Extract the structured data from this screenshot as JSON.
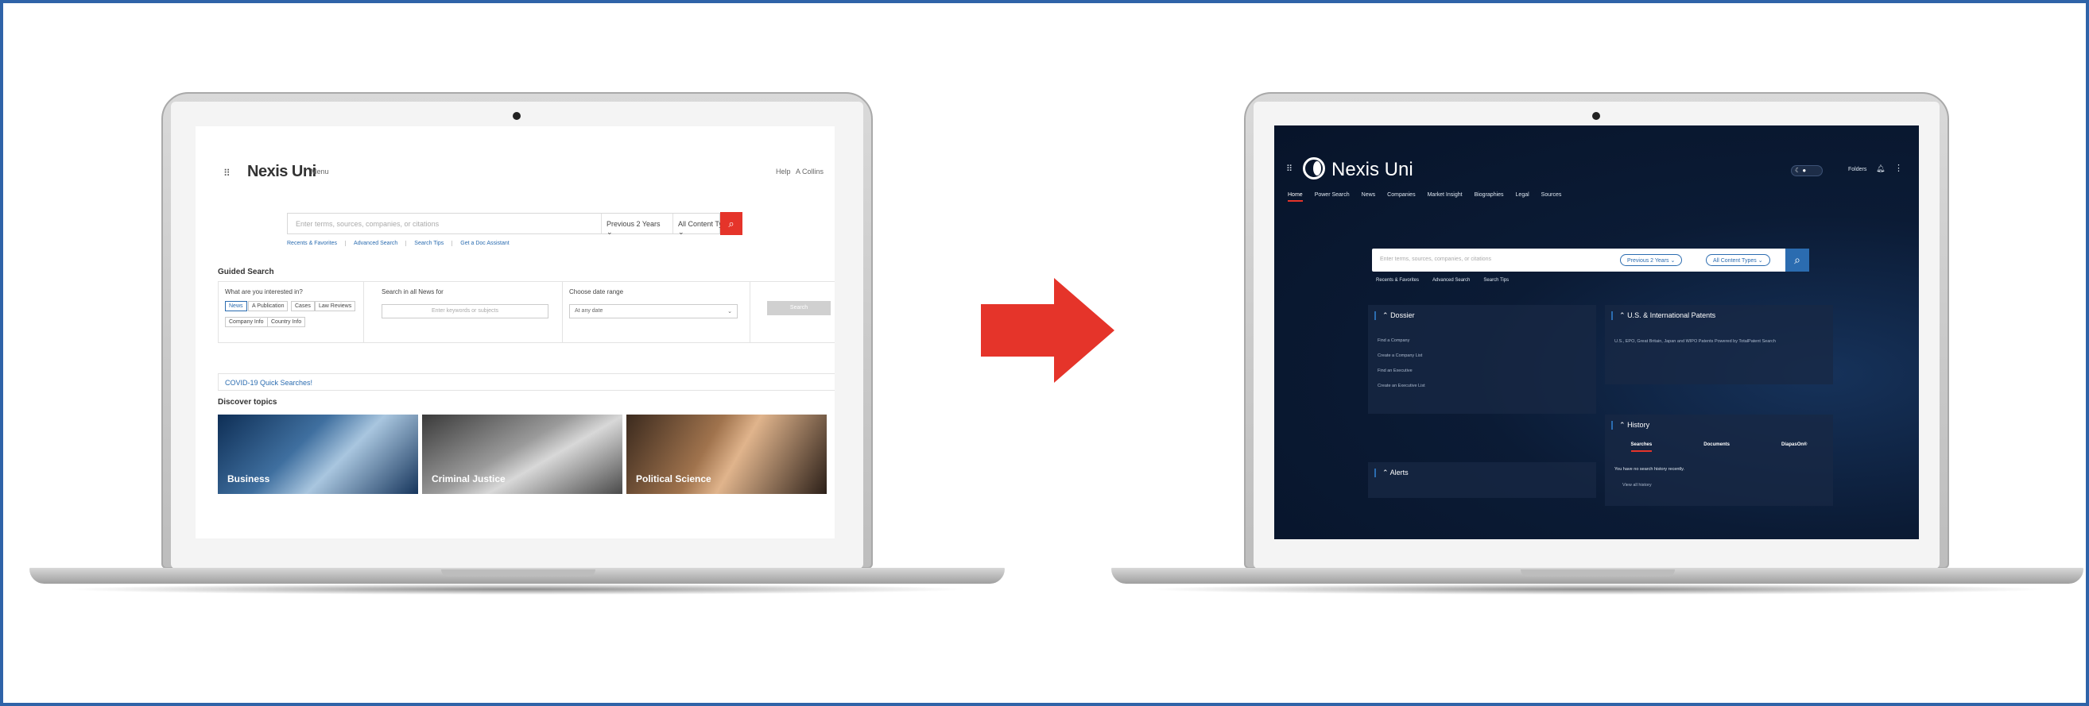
{
  "before": {
    "header": {
      "logo": "Nexis Uni",
      "menu": "Menu",
      "help": "Help",
      "user": "A Collins"
    },
    "search": {
      "placeholder": "Enter terms, sources, companies, or citations",
      "date_range": "Previous 2 Years",
      "content_type": "All Content Types",
      "links": [
        "Recents & Favorites",
        "Advanced Search",
        "Search Tips",
        "Get a Doc Assistant"
      ]
    },
    "guided_search": {
      "title": "Guided Search",
      "interest_label": "What are you interested in?",
      "chips": [
        "News",
        "A Publication",
        "Cases",
        "Law Reviews",
        "Company Info",
        "Country Info"
      ],
      "search_in_label": "Search in all News for",
      "search_in_placeholder": "Enter keywords or subjects",
      "date_label": "Choose date range",
      "date_value": "At any date",
      "search_button": "Search"
    },
    "covid_link": "COVID-19 Quick Searches!",
    "discover": {
      "title": "Discover topics",
      "cards": [
        "Business",
        "Criminal Justice",
        "Political Science"
      ]
    }
  },
  "after": {
    "header": {
      "logo": "Nexis Uni",
      "nav": [
        "Home",
        "Power Search",
        "News",
        "Companies",
        "Market Insight",
        "Biographies",
        "Legal",
        "Sources"
      ],
      "folders": "Folders"
    },
    "search": {
      "placeholder": "Enter terms, sources, companies, or citations",
      "date_range": "Previous 2 Years",
      "content_type": "All Content Types",
      "links": [
        "Recents & Favorites",
        "Advanced Search",
        "Search Tips"
      ]
    },
    "dossier": {
      "title": "Dossier",
      "items": [
        "Find a Company",
        "Create a Company List",
        "Find an Executive",
        "Create an Executive List"
      ]
    },
    "patents": {
      "title": "U.S. & International Patents",
      "text": "U.S., EPO, Great Britain, Japan and WIPO Patents Powered by TotalPatent Search"
    },
    "history": {
      "title": "History",
      "tabs": [
        "Searches",
        "Documents",
        "DiapasOn®"
      ],
      "empty_text": "You have no search history recently.",
      "view_all": "View all history"
    },
    "alerts": {
      "title": "Alerts"
    }
  },
  "colors": {
    "accent_red": "#e5342a",
    "accent_blue": "#2b6cb0",
    "dark_bg": "#0b1b35",
    "border_blue": "#2f63a8"
  }
}
